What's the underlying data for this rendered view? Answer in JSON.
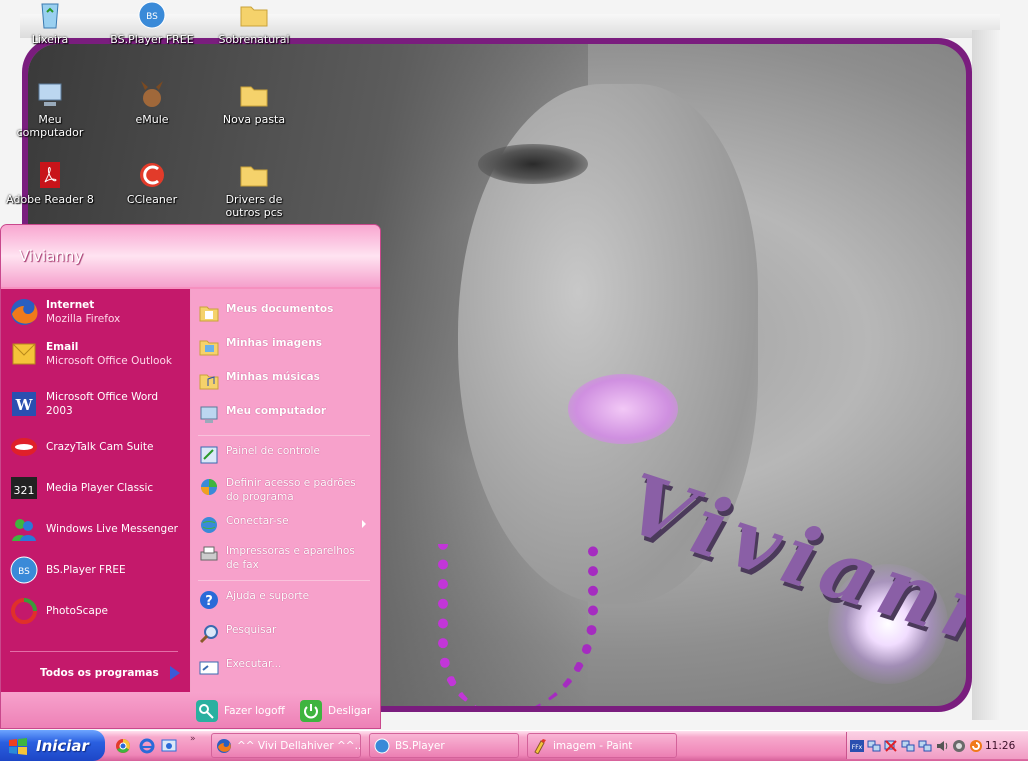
{
  "desktop": {
    "icons": [
      {
        "label": "Lixeira",
        "icon": "recycle-bin-icon"
      },
      {
        "label": "BS.Player FREE",
        "icon": "bsplayer-icon"
      },
      {
        "label": "Sobrenatural",
        "icon": "folder-icon"
      },
      {
        "label": "Meu computador",
        "icon": "computer-icon"
      },
      {
        "label": "eMule",
        "icon": "emule-icon"
      },
      {
        "label": "Nova pasta",
        "icon": "folder-icon"
      },
      {
        "label": "Adobe Reader 8",
        "icon": "adobe-reader-icon"
      },
      {
        "label": "CCleaner",
        "icon": "ccleaner-icon"
      },
      {
        "label": "Drivers de outros pcs",
        "icon": "folder-icon"
      }
    ],
    "wallpaper_signature": "Vivianny"
  },
  "start_menu": {
    "user_name": "Vivianny",
    "pinned": [
      {
        "title": "Internet",
        "subtitle": "Mozilla Firefox",
        "icon": "firefox-icon"
      },
      {
        "title": "Email",
        "subtitle": "Microsoft Office Outlook",
        "icon": "outlook-icon"
      }
    ],
    "recent": [
      {
        "label": "Microsoft Office Word 2003",
        "icon": "word-icon"
      },
      {
        "label": "CrazyTalk Cam Suite",
        "icon": "crazytalk-icon"
      },
      {
        "label": "Media Player Classic",
        "icon": "media-player-classic-icon"
      },
      {
        "label": "Windows Live Messenger",
        "icon": "messenger-icon"
      },
      {
        "label": "BS.Player FREE",
        "icon": "bsplayer-icon"
      },
      {
        "label": "PhotoScape",
        "icon": "photoscape-icon"
      }
    ],
    "all_programs": "Todos os programas",
    "places": [
      {
        "label": "Meus documentos",
        "icon": "my-documents-icon"
      },
      {
        "label": "Minhas imagens",
        "icon": "my-pictures-icon"
      },
      {
        "label": "Minhas músicas",
        "icon": "my-music-icon"
      },
      {
        "label": "Meu computador",
        "icon": "computer-icon"
      }
    ],
    "system": [
      {
        "label": "Painel de controle",
        "icon": "control-panel-icon"
      },
      {
        "label": "Definir acesso e padrões do programa",
        "icon": "program-defaults-icon"
      },
      {
        "label": "Conectar-se",
        "icon": "connect-icon"
      },
      {
        "label": "Impressoras e aparelhos de fax",
        "icon": "printer-icon"
      }
    ],
    "help": [
      {
        "label": "Ajuda e suporte",
        "icon": "help-icon"
      },
      {
        "label": "Pesquisar",
        "icon": "search-icon"
      },
      {
        "label": "Executar...",
        "icon": "run-icon"
      }
    ],
    "logoff": "Fazer logoff",
    "shutdown": "Desligar"
  },
  "taskbar": {
    "start_label": "Iniciar",
    "quick_launch": [
      "chrome-icon",
      "ie-icon",
      "show-desktop-icon"
    ],
    "tasks": [
      {
        "label": "^^ Vivi Dellahiver ^^...",
        "icon": "firefox-icon"
      },
      {
        "label": "BS.Player",
        "icon": "bsplayer-icon"
      },
      {
        "label": "imagem - Paint",
        "icon": "paint-icon"
      }
    ],
    "tray_icons": [
      "ffx-icon",
      "network-icon",
      "network-disabled-icon",
      "network-icon",
      "network-icon",
      "volume-icon",
      "antivirus-icon",
      "update-icon"
    ],
    "clock": "11:26"
  },
  "colors": {
    "accent": "#c4196b",
    "menu_pink": "#f7a1cb",
    "start_blue": "#2a5fe0"
  }
}
